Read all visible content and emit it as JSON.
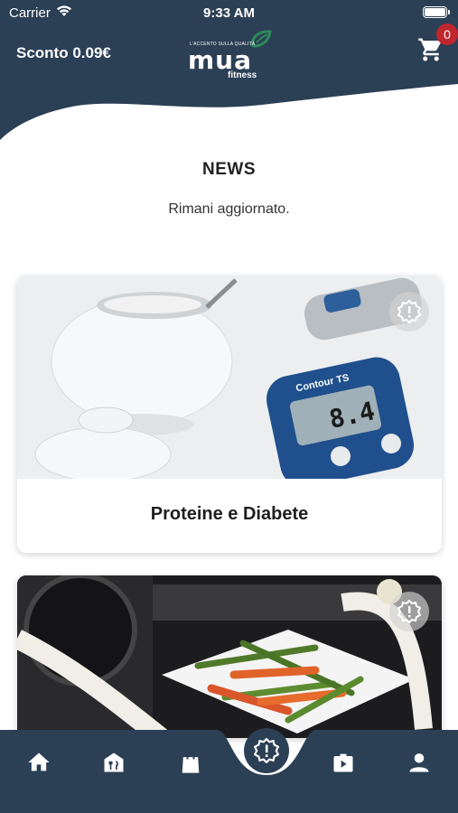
{
  "status_bar": {
    "carrier": "Carrier",
    "time": "9:33 AM"
  },
  "header": {
    "discount": "Sconto 0.09€",
    "logo": {
      "tagline": "L'ACCENTO SULLA QUALITÀ",
      "word": "mua",
      "sub": "fitness"
    },
    "cart_count": "0"
  },
  "news": {
    "title": "NEWS",
    "subtitle": "Rimani aggiornato."
  },
  "cards": [
    {
      "title": "Proteine e Diabete",
      "image": "diabetes-meter-sugar-bowl-photo",
      "meter_reading": "8.4",
      "meter_brand": "Contour TS"
    },
    {
      "title": "",
      "image": "dumbbell-vegetables-tape-measure-photo"
    }
  ],
  "nav": {
    "items": [
      "home-icon",
      "restaurant-icon",
      "shopping-bag-icon",
      "news-alert-icon",
      "video-icon",
      "user-icon"
    ]
  },
  "colors": {
    "header": "#2b3f55",
    "badge": "#c0262d",
    "accent_green": "#2f8a5a"
  }
}
